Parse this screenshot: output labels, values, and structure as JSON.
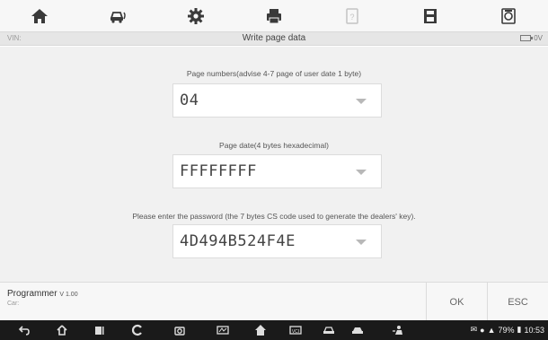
{
  "toolbar": {
    "items": [
      {
        "icon": "home-icon"
      },
      {
        "icon": "vehicle-swap-icon"
      },
      {
        "icon": "settings-icon"
      },
      {
        "icon": "print-icon"
      },
      {
        "icon": "help-icon"
      },
      {
        "icon": "save-icon"
      },
      {
        "icon": "data-logging-icon"
      }
    ]
  },
  "header": {
    "vin_label": "VIN:",
    "title": "Write page data",
    "battery_voltage": "0V"
  },
  "form": {
    "page_numbers": {
      "label": "Page numbers(advise 4-7 page of user date 1 byte)",
      "value": "04"
    },
    "page_date": {
      "label": "Page date(4 bytes hexadecimal)",
      "value": "FFFFFFFF"
    },
    "password": {
      "label": "Please enter the password (the 7 bytes CS code used to generate the dealers' key).",
      "value": "4D494B524F4E"
    }
  },
  "footer": {
    "program_name": "Programmer",
    "version": "V 1.00",
    "car_label": "Car:",
    "ok_label": "OK",
    "esc_label": "ESC"
  },
  "navbar": {
    "battery_percent": "79%",
    "time": "10:53"
  },
  "colors": {
    "toolbar_bg": "#f7f7f7",
    "titlebar_bg": "#e6e6e6",
    "content_bg": "#f1f1f1",
    "navbar_bg": "#1a1a1a",
    "icon_dark": "#3a3a3a"
  }
}
